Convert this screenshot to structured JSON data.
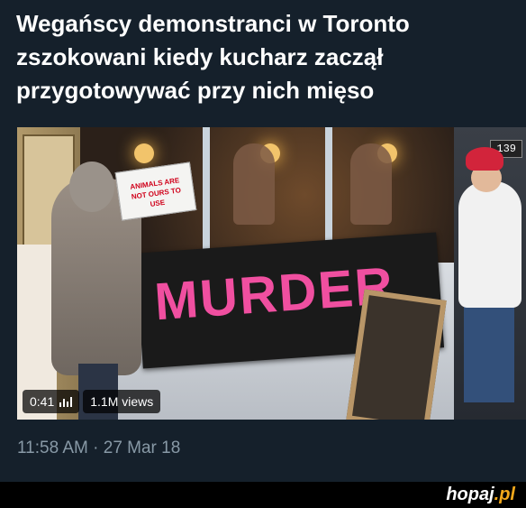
{
  "tweet": {
    "text_line1": "Wegańscy demonstranci w Toronto",
    "text_line2": "zszokowani kiedy kucharz zaczął",
    "text_line3": "przygotowywać przy nich mięso",
    "timestamp": "11:58 AM · 27 Mar 18"
  },
  "video": {
    "duration": "0:41",
    "views": "1.1M views",
    "banner_text": "MURDER",
    "held_sign_text": "ANIMALS ARE NOT OURS TO USE",
    "street_sign": "139",
    "icons": [
      "bars-icon"
    ]
  },
  "footer": {
    "brand_name": "hopaj",
    "brand_tld": ".pl"
  },
  "colors": {
    "background": "#15202b",
    "text": "#ffffff",
    "muted": "#8899a6",
    "banner_pink": "#f04fa0",
    "brand_accent": "#f3a81b"
  }
}
